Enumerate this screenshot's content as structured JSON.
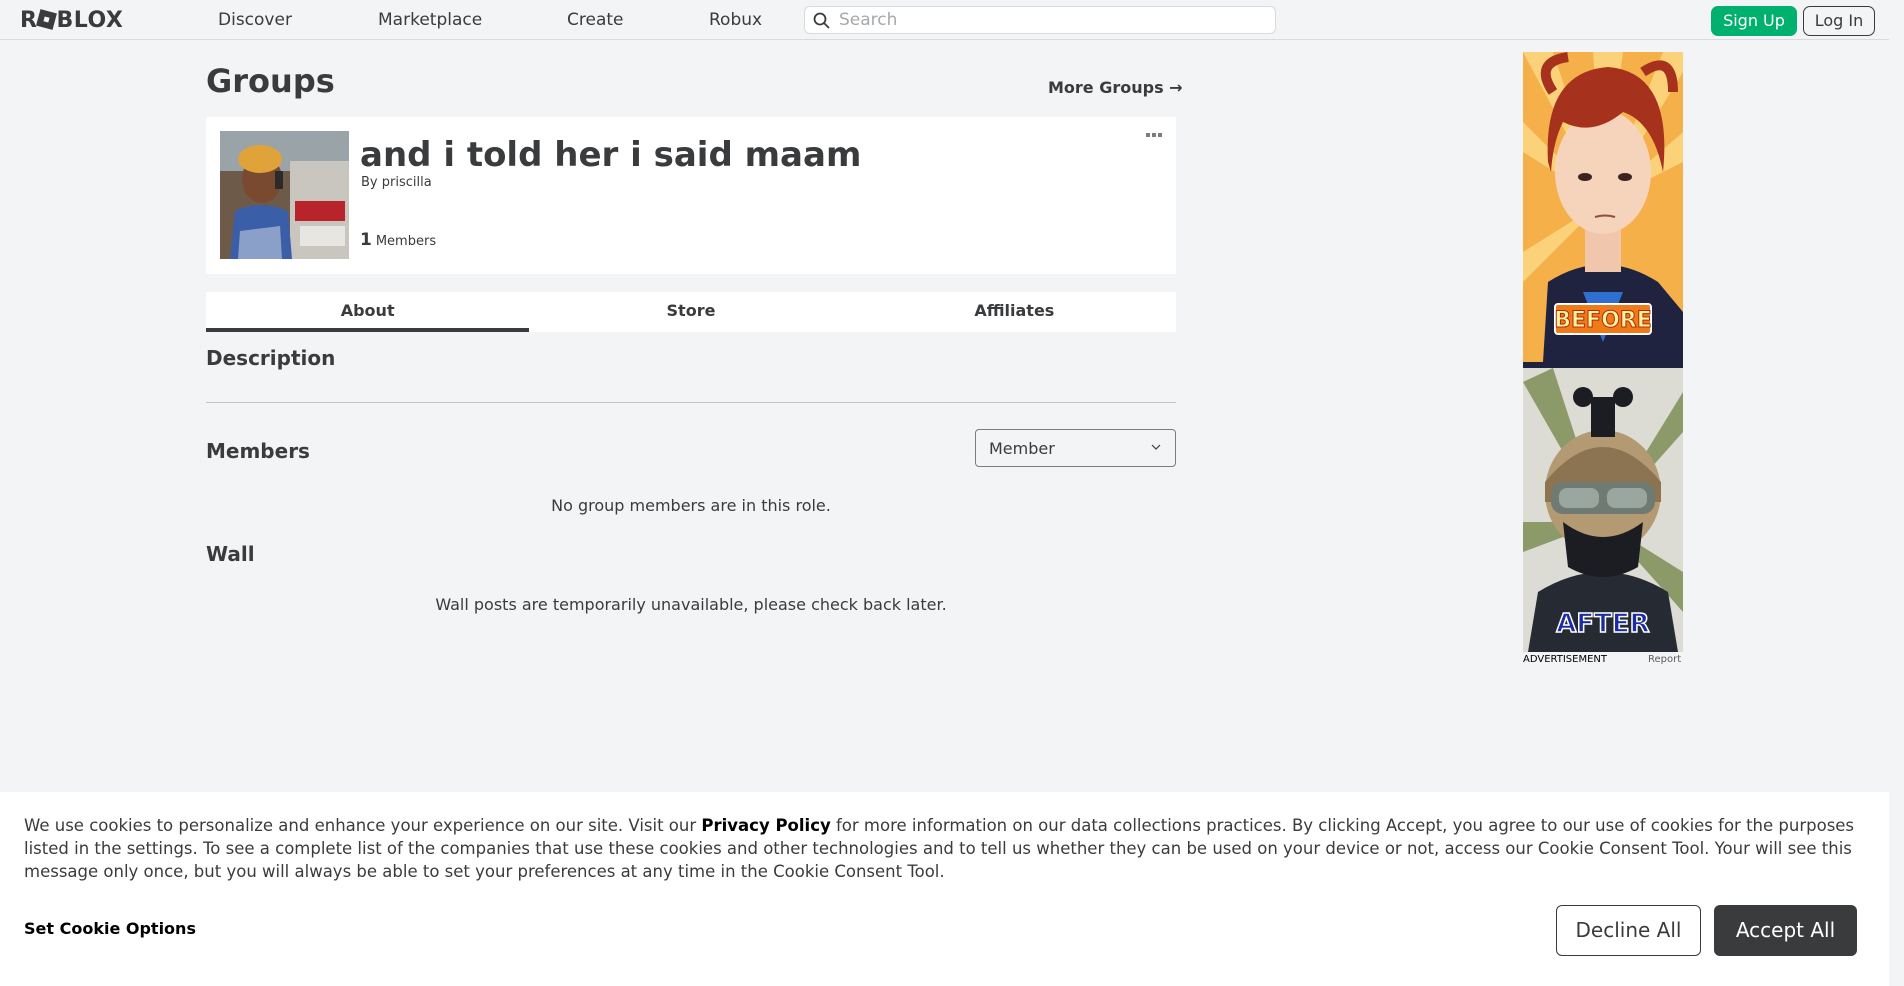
{
  "nav": {
    "logo_text_1": "R",
    "logo_text_2": "BLOX",
    "links": [
      "Discover",
      "Marketplace",
      "Create",
      "Robux"
    ],
    "search_placeholder": "Search",
    "signup": "Sign Up",
    "login": "Log In"
  },
  "page": {
    "title": "Groups",
    "more_groups": "More Groups →"
  },
  "group": {
    "name": "and i told her i said maam",
    "by_label": "By",
    "owner": "priscilla",
    "member_count": "1",
    "members_label": "Members"
  },
  "tabs": [
    "About",
    "Store",
    "Affiliates"
  ],
  "about": {
    "description_heading": "Description",
    "members_heading": "Members",
    "role_selected": "Member",
    "members_empty": "No group members are in this role.",
    "wall_heading": "Wall",
    "wall_message": "Wall posts are temporarily unavailable, please check back later."
  },
  "ad": {
    "label": "ADVERTISEMENT",
    "report": "Report",
    "before_text": "BEFORE",
    "after_text": "AFTER"
  },
  "cookie": {
    "text_1": "We use cookies to personalize and enhance your experience on our site. Visit our ",
    "privacy_link": "Privacy Policy",
    "text_2": " for more information on our data collections practices. By clicking Accept, you agree to our use of cookies for the purposes listed in the settings. To see a complete list of the companies that use these cookies and other technologies and to tell us whether they can be used on your device or not, access our Cookie Consent Tool. Your will see this message only once, but you will always be able to set your preferences at any time in the Cookie Consent Tool.",
    "set_options": "Set Cookie Options",
    "decline": "Decline All",
    "accept": "Accept All"
  },
  "colors": {
    "accent_green": "#00b06f",
    "text_dark": "#393b3d",
    "page_bg": "#f2f4f5"
  }
}
